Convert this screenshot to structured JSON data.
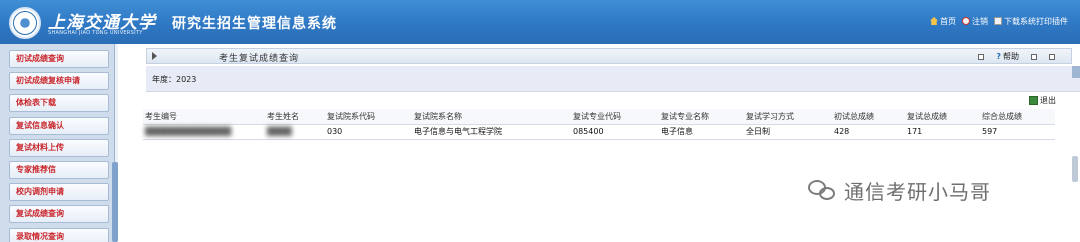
{
  "header": {
    "university_name": "上海交通大学",
    "university_en": "SHANGHAI JIAO TONG UNIVERSITY",
    "system_title": "研究生招生管理信息系统",
    "links": [
      {
        "label": "首页",
        "icon": "home-icon"
      },
      {
        "label": "注销",
        "icon": "logout-icon"
      },
      {
        "label": "下载系统打印插件",
        "icon": "download-icon"
      }
    ]
  },
  "sidebar": {
    "items": [
      {
        "label": "初试成绩查询"
      },
      {
        "label": "初试成绩复核申请"
      },
      {
        "label": "体检表下载"
      },
      {
        "label": "复试信息确认"
      },
      {
        "label": "复试材料上传"
      },
      {
        "label": "专家推荐信"
      },
      {
        "label": "校内调剂申请"
      },
      {
        "label": "复试成绩查询"
      },
      {
        "label": "录取情况查询"
      }
    ]
  },
  "panel": {
    "title": "考生复试成绩查询",
    "help_label": "帮助"
  },
  "year": {
    "label": "年度：",
    "value": "2023"
  },
  "export_label": "退出",
  "table": {
    "columns": [
      "考生编号",
      "考生姓名",
      "复试院系代码",
      "复试院系名称",
      "复试专业代码",
      "复试专业名称",
      "复试学习方式",
      "初试总成绩",
      "复试总成绩",
      "综合总成绩"
    ],
    "rows": [
      [
        "██████████████",
        "████",
        "030",
        "电子信息与电气工程学院",
        "085400",
        "电子信息",
        "全日制",
        "428",
        "171",
        "597"
      ]
    ]
  },
  "watermark": {
    "text": "通信考研小马哥"
  }
}
